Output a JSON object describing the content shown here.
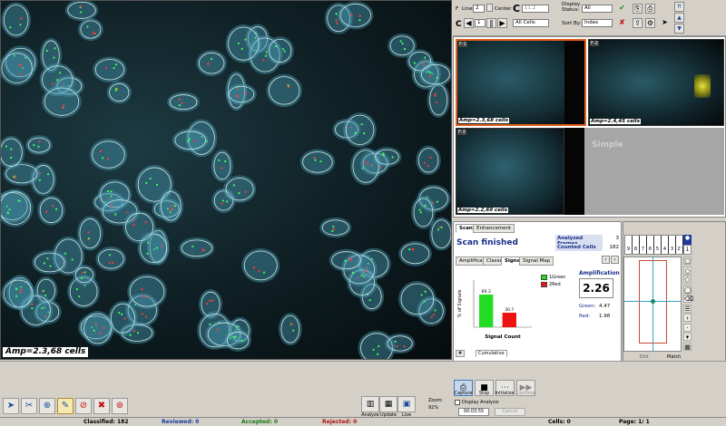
{
  "main_image": {
    "caption": "Amp=2.3,68 cells"
  },
  "toolbar": {
    "lines_label": "Lines",
    "lines_value": "2",
    "center_label": "Center",
    "field_c_value": "11.2",
    "all_cells_value": "All Cells",
    "display_status_label": "Display Status:",
    "display_status_value": "All",
    "sort_by_label": "Sort By:",
    "sort_by_value": "Index",
    "stepper_value": "1",
    "f_label": "F",
    "c_label": "C",
    "c2_label": "C"
  },
  "thumbnails": [
    {
      "id": "F-1",
      "caption": "Amp=2.3,68 cells"
    },
    {
      "id": "F-2",
      "caption": "Amp=2.4,45 cells"
    },
    {
      "id": "F-3",
      "caption": "Amp=2.2,69 cells"
    }
  ],
  "thumbnail_watermark": "Simple",
  "scan_panel": {
    "tabs": [
      "Scan",
      "Enhancement"
    ],
    "title": "Scan finished",
    "analyzed_frames_label": "Analyzed Frames",
    "analyzed_frames_value": "3",
    "counted_cells_label": "Counted Cells",
    "counted_cells_value": "182",
    "sub_tabs": [
      "Amplification",
      "Classes",
      "Signals",
      "Signal Map"
    ],
    "legend": [
      "1Green",
      "2Red"
    ],
    "amplification_label": "Amplification",
    "amplification_value": "2.26",
    "green_label": "Green:",
    "green_value": "4.47",
    "red_label": "Red:",
    "red_value": "1.98",
    "bottom_tabs": [
      "#",
      "Cumulative"
    ]
  },
  "chart_data": {
    "type": "bar",
    "categories": [
      "1Green",
      "2Red"
    ],
    "values": [
      69.3,
      30.7
    ],
    "title": "",
    "xlabel": "Signal Count",
    "ylabel": "% of Signals",
    "data_labels": [
      "69.3",
      "30.7"
    ],
    "colors": [
      "#22dd22",
      "#ee1111"
    ],
    "ylim": [
      0,
      100
    ]
  },
  "control_strip": {
    "digits": [
      "9",
      "8",
      "7",
      "6",
      "5",
      "4",
      "3",
      "2'",
      "1"
    ],
    "edit_label": "Edit",
    "match_label": "Match"
  },
  "bottom": {
    "analyze_label": "Analyze",
    "update_label": "Update",
    "live_label": "Live",
    "zoom_label": "Zoom:",
    "zoom_value": "92%",
    "capture_label": "Capture",
    "stop_label": "Stop",
    "initialize_label": "Initialize",
    "continue_label": "Continue",
    "display_analysis_label": "Display Analysis",
    "elapsed_time": "00:03:55",
    "cancel_label": "Cancel"
  },
  "status": {
    "classified": "Classified: 182",
    "reviewed": "Reviewed: 0",
    "accepted": "Accepted: 0",
    "rejected": "Rejected: 0",
    "cells": "Cells: 0",
    "page": "Page: 1/ 1"
  },
  "colors": {
    "accent_blue": "#1a2e8a",
    "selected_frame": "#e06020",
    "green_bar": "#22dd22",
    "red_bar": "#ee1111"
  }
}
